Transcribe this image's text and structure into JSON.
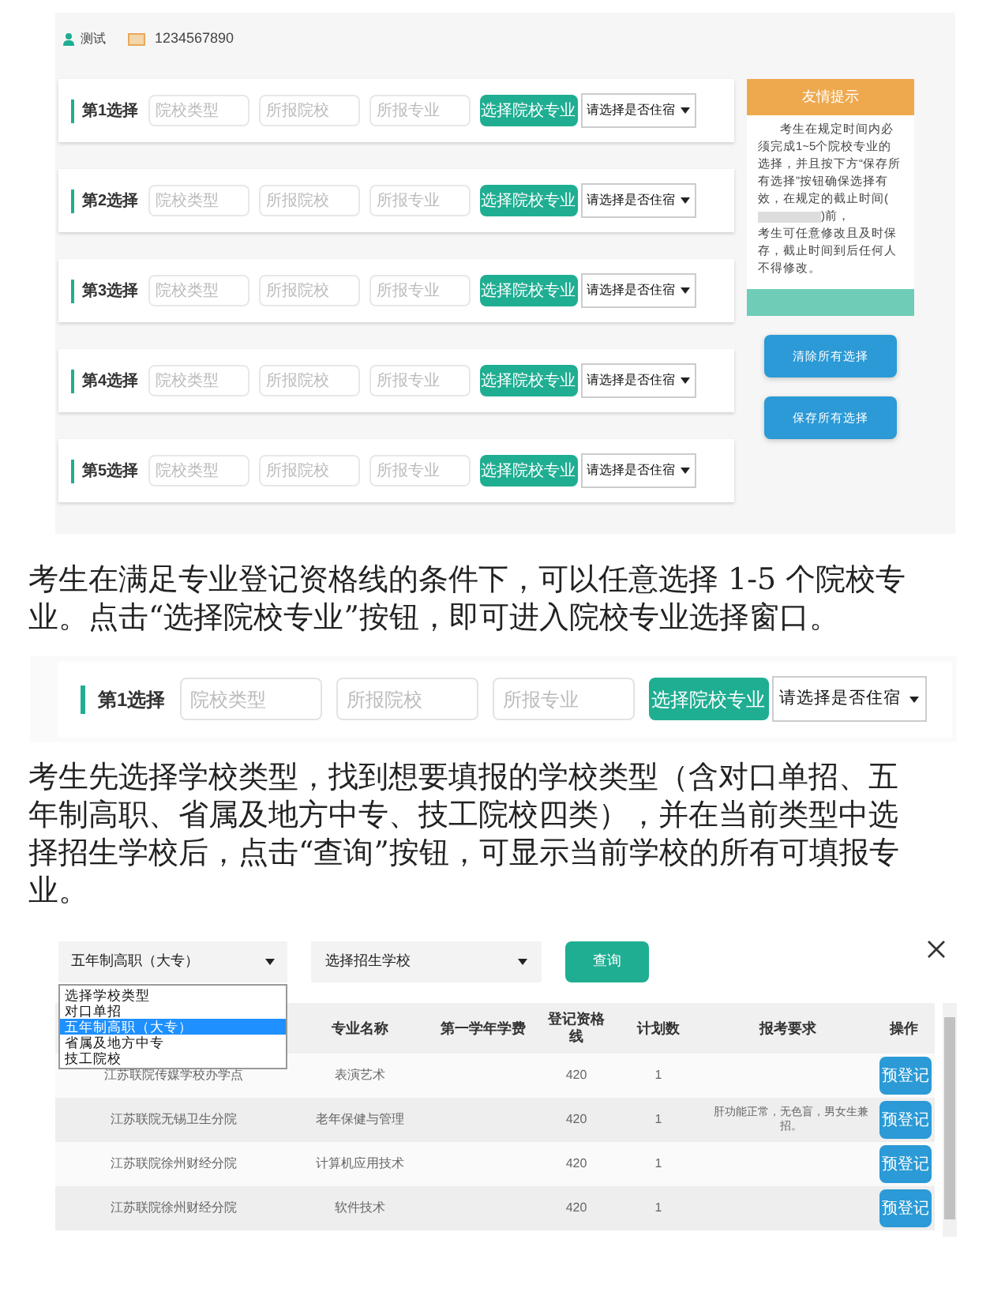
{
  "screen_1": {
    "user": "测试",
    "id_number": "1234567890",
    "choices": [
      {
        "label": "第1选择",
        "placeholders": [
          "院校类型",
          "所报院校",
          "所报专业"
        ],
        "button": "选择院校专业",
        "select": "请选择是否住宿"
      },
      {
        "label": "第2选择",
        "placeholders": [
          "院校类型",
          "所报院校",
          "所报专业"
        ],
        "button": "选择院校专业",
        "select": "请选择是否住宿"
      },
      {
        "label": "第3选择",
        "placeholders": [
          "院校类型",
          "所报院校",
          "所报专业"
        ],
        "button": "选择院校专业",
        "select": "请选择是否住宿"
      },
      {
        "label": "第4选择",
        "placeholders": [
          "院校类型",
          "所报院校",
          "所报专业"
        ],
        "button": "选择院校专业",
        "select": "请选择是否住宿"
      },
      {
        "label": "第5选择",
        "placeholders": [
          "院校类型",
          "所报院校",
          "所报专业"
        ],
        "button": "选择院校专业",
        "select": "请选择是否住宿"
      }
    ],
    "tip": {
      "title": "友情提示",
      "text_before": "考生在规定时间内必须完成1~5个院校专业的选择，并且按下方“保存所有选择”按钮确保选择有效，在规定的截止时间(",
      "text_after": ")前，",
      "text_end": "考生可任意修改且及时保存，截止时间到后任何人不得修改。"
    },
    "buttons": [
      "清除所有选择",
      "保存所有选择"
    ]
  },
  "paragraph_1": "考生在满足专业登记资格线的条件下，可以任意选择 1-5 个院校专业。点击“选择院校专业”按钮，即可进入院校专业选择窗口。",
  "screen_2": {
    "label": "第1选择",
    "placeholders": [
      "院校类型",
      "所报院校",
      "所报专业"
    ],
    "button": "选择院校专业",
    "select": "请选择是否住宿"
  },
  "paragraph_2": "考生先选择学校类型，找到想要填报的学校类型（含对口单招、五年制高职、省属及地方中专、技工院校四类），并在当前类型中选择招生学校后，点击“查询”按钮，可显示当前学校的所有可填报专业。",
  "screen_3": {
    "type_select": "五年制高职（大专）",
    "school_select": "选择招生学校",
    "query_button": "查询",
    "type_options": [
      {
        "label": "选择学校类型",
        "selected": false
      },
      {
        "label": "对口单招",
        "selected": false
      },
      {
        "label": "五年制高职（大专）",
        "selected": true
      },
      {
        "label": "省属及地方中专",
        "selected": false
      },
      {
        "label": "技工院校",
        "selected": false
      }
    ],
    "columns": [
      "专业名称",
      "第一学年学费",
      "登记资格线",
      "计划数",
      "报考要求",
      "操作"
    ],
    "rows": [
      {
        "school": "江苏联院传媒学校办学点",
        "major": "表演艺术",
        "line": "420",
        "plan": "1",
        "action": "预登记"
      },
      {
        "school": "江苏联院无锡卫生分院",
        "major": "老年保健与管理",
        "line": "420",
        "plan": "1",
        "requirement": "肝功能正常，无色盲，男女生兼招。",
        "action": "预登记"
      },
      {
        "school": "江苏联院徐州财经分院",
        "major": "计算机应用技术",
        "line": "420",
        "plan": "1",
        "action": "预登记"
      },
      {
        "school": "江苏联院徐州财经分院",
        "major": "软件技术",
        "line": "420",
        "plan": "1",
        "action": "预登记"
      }
    ]
  }
}
